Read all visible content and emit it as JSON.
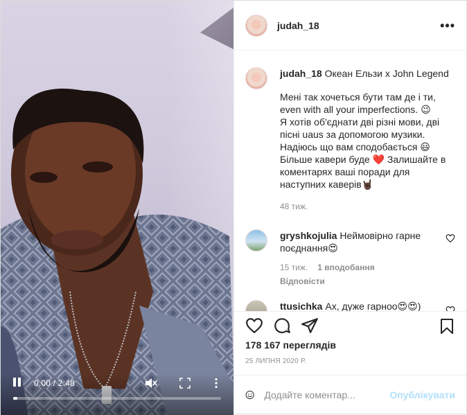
{
  "post": {
    "username": "judah_18",
    "more_icon": "more-horizontal-icon"
  },
  "video": {
    "time": "0.00 / 2:48",
    "progress": 0.0
  },
  "caption": {
    "username": "judah_18",
    "title": "Океан Ельзи x John Legend",
    "text": "Мені так хочеться бути там де і ти,\neven with all your imperfections. 😉\nЯ хотів об'єднати дві різні мови, дві\nпісні uaus за допомогою музики.\nНадіюсь що вам сподобається 😃\nБільше кавери буде ❤️ Залишайте в\nкоментарях ваші поради для\nнаступних каверів🤘🏿",
    "age": "48 тиж."
  },
  "comments": [
    {
      "username": "gryshkojulia",
      "text": "Неймовірно гарне поєднання😍",
      "age": "15 тиж.",
      "likes": "1 вподобання",
      "reply": "Відповісти"
    },
    {
      "username": "ttusichka",
      "text": "Ах, дуже гарноо😍😍)"
    }
  ],
  "stats": {
    "views": "178 167 переглядів",
    "date": "25 ЛИПНЯ 2020 Р."
  },
  "composer": {
    "placeholder": "Додайте коментар...",
    "post_label": "Опублікувати"
  }
}
